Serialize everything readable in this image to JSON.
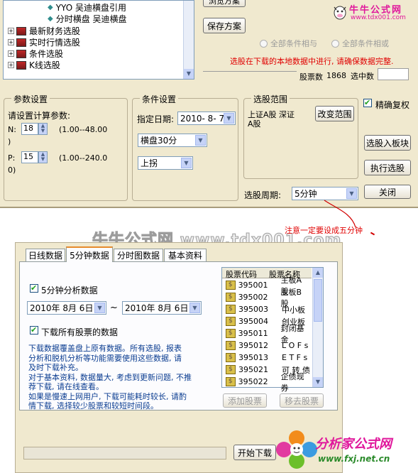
{
  "top_window": {
    "tree_items": [
      {
        "label": "YYO 吴迪横盘引用",
        "type": "leaf"
      },
      {
        "label": "分时横盘 吴迪横盘",
        "type": "leaf"
      },
      {
        "label": "最新财务选股",
        "type": "folder"
      },
      {
        "label": "实时行情选股",
        "type": "folder"
      },
      {
        "label": "条件选股",
        "type": "folder"
      },
      {
        "label": "K线选股",
        "type": "folder"
      }
    ],
    "partial_button_label": "浏览方案",
    "save_plan_button": "保存方案",
    "radio_all_and": "全部条件相与",
    "radio_all_or": "全部条件相或",
    "warning_text": "选股在下载的本地数据中进行, 请确保数据完整.",
    "stock_count_label": "股票数",
    "stock_count_value": "1868",
    "selected_label": "选中数",
    "selected_value": "",
    "params": {
      "title": "参数设置",
      "prompt": "请设置计算参数:",
      "n_label": "N:",
      "n_value": "18",
      "n_range": "(1.00--48.00",
      "n_range_tail": ")",
      "p_label": "P:",
      "p_value": "15",
      "p_range": "(1.00--240.0",
      "p_range_tail": "0)"
    },
    "conditions": {
      "title": "条件设置",
      "date_label": "指定日期:",
      "date_value": "2010- 8- 7",
      "formula_value": "横盘30分",
      "direction_value": "上拐"
    },
    "scope": {
      "title": "选股范围",
      "scope_text_line1": "上证A股 深证",
      "scope_text_line2": "A股",
      "change_button": "改变范围"
    },
    "exact_adjust_label": "精确复权",
    "exact_adjust_checked": true,
    "to_sector_button": "选股入板块",
    "run_button": "执行选股",
    "close_button": "关闭",
    "period_label": "选股周期:",
    "period_value": "5分钟"
  },
  "watermarks": {
    "top_right_brand": "牛牛公式网",
    "top_right_url": "www.tdx001.com",
    "center_text": "牛牛公式网 www.tdx001.com",
    "bottom_right_brand": "分析家公式网",
    "bottom_right_url": "www.fxj.net.cn"
  },
  "annotation_text": "注意一定要设成五分钟",
  "bottom_window": {
    "tabs": [
      "日线数据",
      "5分钟数据",
      "分时图数据",
      "基本资料"
    ],
    "active_tab": 1,
    "five_min_label": "5分钟分析数据",
    "five_min_checked": true,
    "date_from": "2010年 8月 6日",
    "date_separator": "~",
    "date_to": "2010年 8月 6日",
    "download_all_label": "下载所有股票的数据",
    "download_all_checked": true,
    "description": [
      "下载数据覆盖盘上原有数据。所有选股, 报表",
      "分析和脱机分析等功能需要使用这些数据, 请",
      "及时下载补充。",
      "对于基本资料, 数据量大, 考虑到更新问题, 不推",
      "荐下载, 请在线查看。",
      "如果是慢速上网用户, 下载可能耗时较长, 请酌",
      "情下载, 选择较少股票和较短时间段。"
    ],
    "list_headers": [
      "股票代码",
      "股票名称"
    ],
    "list_rows": [
      {
        "code": "395001",
        "name": "主板A 股"
      },
      {
        "code": "395002",
        "name": "主板B 股"
      },
      {
        "code": "395003",
        "name": "中小板"
      },
      {
        "code": "395004",
        "name": "创业板"
      },
      {
        "code": "395011",
        "name": "封闭基金"
      },
      {
        "code": "395012",
        "name": "L O F s"
      },
      {
        "code": "395013",
        "name": "E T F s"
      },
      {
        "code": "395021",
        "name": "可 转 债"
      },
      {
        "code": "395022",
        "name": "企债现券"
      }
    ],
    "add_stock_button": "添加股票",
    "remove_stock_button": "移去股票",
    "start_download_button": "开始下载"
  },
  "colors": {
    "window_bg": "#f0e9cf",
    "warning_red": "#e00000",
    "annotation_red": "#e00000",
    "watermark_magenta": "#e0189c"
  }
}
